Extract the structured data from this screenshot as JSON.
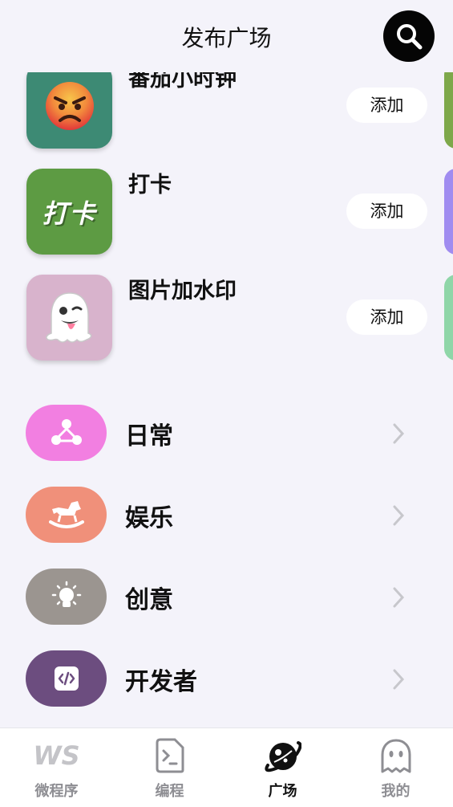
{
  "header": {
    "title": "发布广场"
  },
  "apps": [
    {
      "name": "番茄小时钟",
      "add_label": "添加",
      "icon": "angry-face-icon",
      "icon_text": "😡",
      "color": "#3d8a74",
      "peek_color": "#7ea84a"
    },
    {
      "name": "打卡",
      "add_label": "添加",
      "icon": "check-in-icon",
      "icon_text": "打卡",
      "color": "#5d9b43",
      "peek_color": "#a08cf0"
    },
    {
      "name": "图片加水印",
      "add_label": "添加",
      "icon": "ghost-icon",
      "icon_text": "👻",
      "color": "#d8b3cc",
      "peek_color": "#8fd6a8"
    }
  ],
  "categories": [
    {
      "label": "日常",
      "icon": "community-icon",
      "color": "#f27fe1"
    },
    {
      "label": "娱乐",
      "icon": "rocking-horse-icon",
      "color": "#f0907a"
    },
    {
      "label": "创意",
      "icon": "lightbulb-icon",
      "color": "#9b9590"
    },
    {
      "label": "开发者",
      "icon": "code-icon",
      "color": "#6c4d7f"
    }
  ],
  "tabbar": {
    "tabs": [
      {
        "label": "微程序",
        "icon_text": "WS",
        "icon": "ws-logo-icon",
        "active": false
      },
      {
        "label": "编程",
        "icon": "code-file-icon",
        "active": false
      },
      {
        "label": "广场",
        "icon": "planet-icon",
        "active": true
      },
      {
        "label": "我的",
        "icon": "ghost-profile-icon",
        "active": false
      }
    ]
  }
}
